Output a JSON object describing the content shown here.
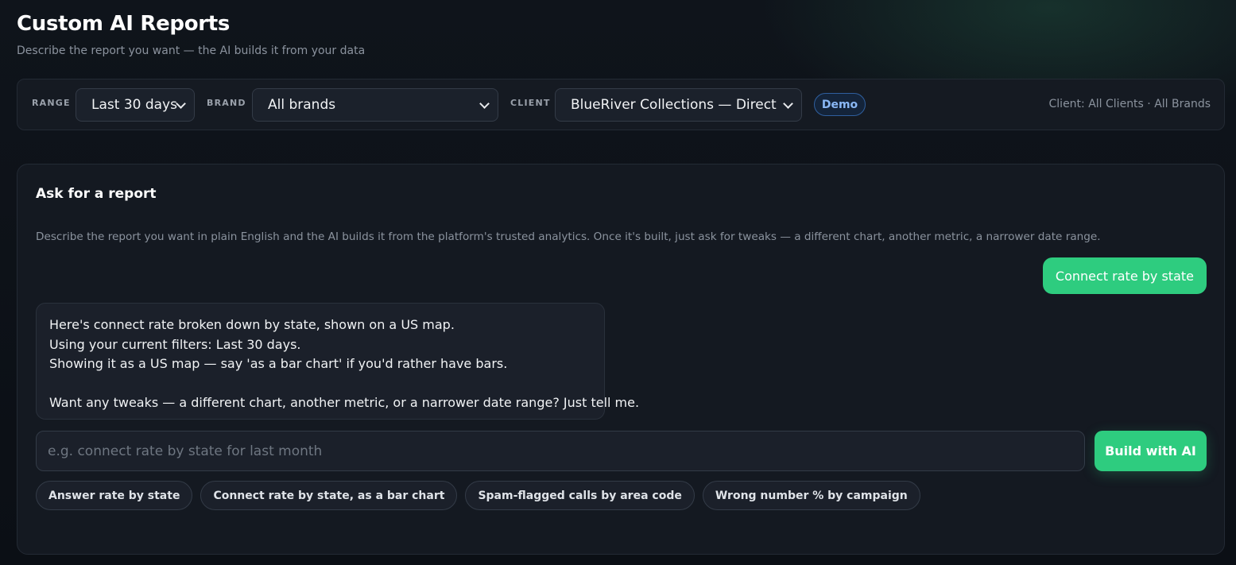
{
  "header": {
    "title": "Custom AI Reports",
    "subtitle": "Describe the report you want — the AI builds it from your data"
  },
  "filters": {
    "range_label": "RANGE",
    "range_value": "Last 30 days",
    "brand_label": "BRAND",
    "brand_value": "All brands",
    "client_label": "CLIENT",
    "client_value": "BlueRiver Collections — Direct",
    "demo_badge": "Demo",
    "scope_text": "Client: All Clients · All Brands"
  },
  "report": {
    "title": "Ask for a report",
    "description": "Describe the report you want in plain English and the AI builds it from the platform's trusted analytics. Once it's built, just ask for tweaks — a different chart, another metric, a narrower date range.",
    "messages": {
      "user": "Connect rate by state",
      "ai_lines": [
        "Here's connect rate broken down by state, shown on a US map.",
        "Using your current filters: Last 30 days.",
        "Showing it as a US map — say 'as a bar chart' if you'd rather have bars.",
        "Want any tweaks — a different chart, another metric, or a narrower date range? Just tell me."
      ]
    },
    "input": {
      "placeholder": "e.g. connect rate by state for last month",
      "value": ""
    },
    "build_label": "Build with AI",
    "suggestions": [
      "Answer rate by state",
      "Connect rate by state, as a bar chart",
      "Spam-flagged calls by area code",
      "Wrong number % by campaign"
    ]
  },
  "colors": {
    "accent": "#2ecc7f",
    "badge": "#8ab8f5",
    "background": "#0f141b"
  },
  "icons": {
    "select_arrow": "chevron-down-icon"
  }
}
